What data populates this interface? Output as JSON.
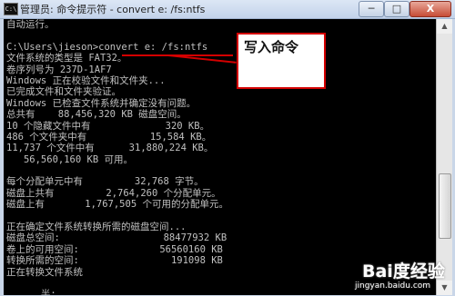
{
  "window": {
    "icon_label": "C:\\",
    "title": "管理员: 命令提示符 - convert  e: /fs:ntfs",
    "minimize": "─",
    "maximize": "□",
    "close": "X"
  },
  "console_lines": [
    "自动运行。",
    "",
    "C:\\Users\\jieson>convert e: /fs:ntfs",
    "文件系统的类型是 FAT32。",
    "卷序列号为 237D-1AF7",
    "Windows 正在校验文件和文件夹...",
    "已完成文件和文件夹验证。",
    "Windows 已检查文件系统并确定没有问题。",
    "总共有    88,456,320 KB 磁盘空间。",
    "10 个隐藏文件中有             320 KB。",
    "486 个文件夹中有           15,584 KB。",
    "11,737 个文件中有      31,880,224 KB。",
    "   56,560,160 KB 可用。",
    "",
    "每个分配单元中有         32,768 字节。",
    "磁盘上共有         2,764,260 个分配单元。",
    "磁盘上有       1,767,505 个可用的分配单元。",
    "",
    "正在确定文件系统转换所需的磁盘空间...",
    "磁盘总空间:                  88477932 KB",
    "卷上的可用空间:              56560160 KB",
    "转换所需的空间:                191098 KB",
    "正在转换文件系统",
    "",
    "      半:"
  ],
  "annotation": {
    "text": "写入命令",
    "color": "#d40000"
  },
  "watermark": {
    "logo": "Bai度经验",
    "url": "jingyan.baidu.com"
  },
  "colors": {
    "console_bg": "#000000",
    "console_text": "#c0c0c0",
    "annotation": "#d40000"
  }
}
